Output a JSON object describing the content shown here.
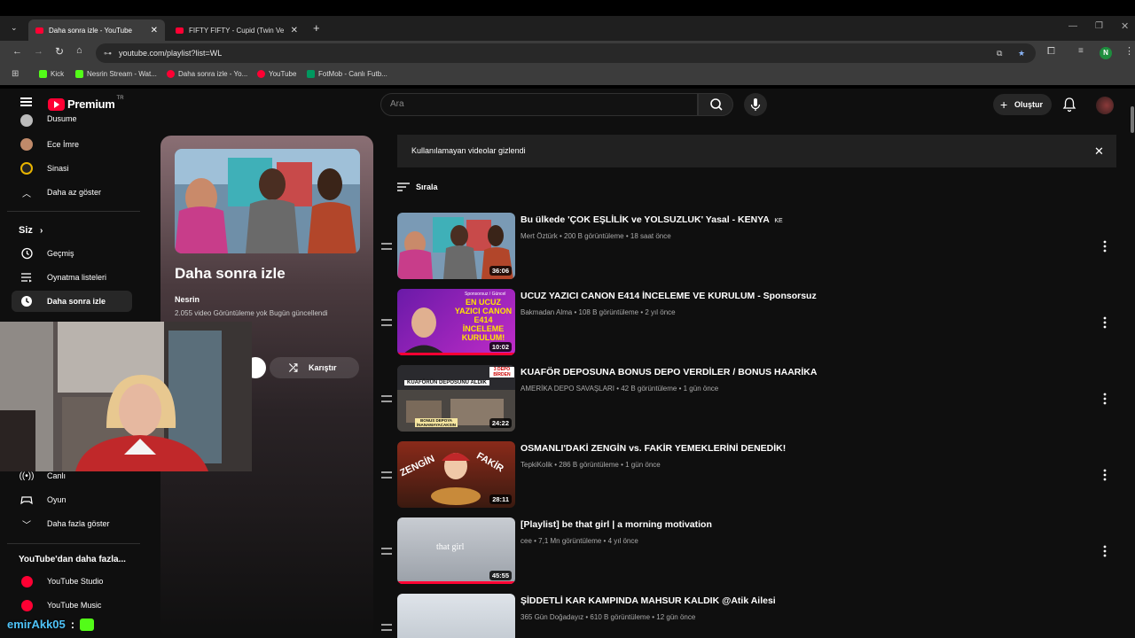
{
  "browser": {
    "tabs": [
      {
        "title": "Daha sonra izle - YouTube",
        "active": true
      },
      {
        "title": "FIFTY FIFTY - Cupid (Twin Versi",
        "active": false
      }
    ],
    "url": "youtube.com/playlist?list=WL",
    "bookmarks": [
      "Kick",
      "Nesrin Stream - Wat...",
      "Daha sonra izle - Yo...",
      "YouTube",
      "FotMob - Canlı Futb..."
    ],
    "profile_initial": "N"
  },
  "youtube": {
    "logo": "Premium",
    "country": "TR",
    "search_placeholder": "Ara",
    "create_label": "Oluştur"
  },
  "sidebar": {
    "top_items": [
      {
        "label": "Dusume"
      },
      {
        "label": "Ece İmre"
      },
      {
        "label": "Sinasi"
      },
      {
        "label": "Daha az göster"
      }
    ],
    "you_heading": "Siz",
    "you_items": [
      {
        "label": "Geçmiş"
      },
      {
        "label": "Oynatma listeleri"
      },
      {
        "label": "Daha sonra izle"
      }
    ],
    "explore_items": [
      {
        "label": "Canlı"
      },
      {
        "label": "Oyun"
      },
      {
        "label": "Daha fazla göster"
      }
    ],
    "more_heading": "YouTube'dan daha fazla...",
    "more_items": [
      {
        "label": "YouTube Studio"
      },
      {
        "label": "YouTube Music"
      }
    ]
  },
  "playlist": {
    "title": "Daha sonra izle",
    "owner": "Nesrin",
    "meta": "2.055 video   Görüntüleme yok   Bugün güncellendi",
    "shuffle_label": "Karıştır"
  },
  "banner": {
    "text": "Kullanılamayan videolar gizlendi"
  },
  "sort_label": "Sırala",
  "videos": [
    {
      "title": "Bu ülkede 'ÇOK EŞLİLİK ve YOLSUZLUK' Yasal - KENYA",
      "flag": "KE",
      "channel": "Mert Öztürk",
      "views": "200 B görüntüleme",
      "age": "18 saat önce",
      "duration": "36:06",
      "progress": 0
    },
    {
      "title": "UCUZ YAZICI CANON E414 İNCELEME VE KURULUM - Sponsorsuz",
      "flag": "",
      "channel": "Bakmadan Alma",
      "views": "108 B görüntüleme",
      "age": "2 yıl önce",
      "duration": "10:02",
      "progress": 1
    },
    {
      "title": "KUAFÖR DEPOSUNA BONUS DEPO VERDİLER / BONUS HAARİKA",
      "flag": "",
      "channel": "AMERİKA DEPO SAVAŞLARI",
      "views": "42 B görüntüleme",
      "age": "1 gün önce",
      "duration": "24:22",
      "progress": 0
    },
    {
      "title": "OSMANLI'DAKİ ZENGİN vs. FAKİR YEMEKLERİNİ DENEDİK!",
      "flag": "",
      "channel": "TepkiKolik",
      "views": "286 B görüntüleme",
      "age": "1 gün önce",
      "duration": "28:11",
      "progress": 0
    },
    {
      "title": "[Playlist] be that girl | a morning motivation",
      "flag": "",
      "channel": "cee",
      "views": "7,1 Mn görüntüleme",
      "age": "4 yıl önce",
      "duration": "45:55",
      "progress": 1
    },
    {
      "title": "ŞİDDETLİ KAR KAMPINDA MAHSUR KALDIK @Atik Ailesi",
      "flag": "",
      "channel": "365 Gün Doğadayız",
      "views": "610 B görüntüleme",
      "age": "12 gün önce",
      "duration": "",
      "progress": 0
    }
  ],
  "thumb_text": {
    "v2_top": "Sponsorsuz / Güncel",
    "v2_main": "EN UCUZ YAZICI CANON E414 İNCELEME KURULUM!",
    "v3_tag": "3 DEPO BİRDEN",
    "v3_banner": "KUAFÖRÜN DEPOSUNU ALDIK",
    "v3_bottom": "BONUS DEPOYA İNANAMAYACAKSIN",
    "v4_left": "ZENGİN",
    "v4_right": "FAKİR",
    "v5_text": "that girl"
  },
  "overlay_chat": {
    "user": "emirAkk05",
    "sep": ":"
  },
  "colors": {
    "brand_red": "#ff0033",
    "bg": "#0f0f0f",
    "surface": "#272727"
  }
}
